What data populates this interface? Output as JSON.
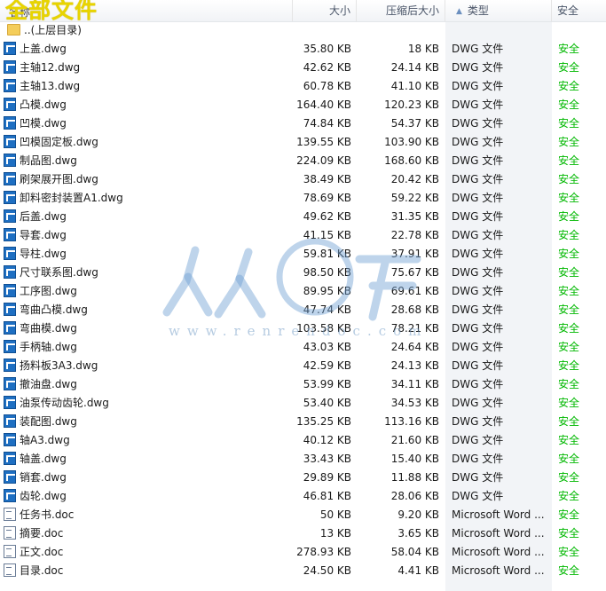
{
  "header": {
    "overlay_title": "全部文件",
    "col_name": "名称",
    "col_size": "大小",
    "col_compressed": "压缩后大小",
    "col_type": "类型",
    "col_security": "安全"
  },
  "parent_dir": "..(上层目录)",
  "files": [
    {
      "name": "上盖.dwg",
      "size": "35.80 KB",
      "compressed": "18 KB",
      "type": "DWG 文件",
      "security": "安全",
      "icon": "dwg"
    },
    {
      "name": "主轴12.dwg",
      "size": "42.62 KB",
      "compressed": "24.14 KB",
      "type": "DWG 文件",
      "security": "安全",
      "icon": "dwg"
    },
    {
      "name": "主轴13.dwg",
      "size": "60.78 KB",
      "compressed": "41.10 KB",
      "type": "DWG 文件",
      "security": "安全",
      "icon": "dwg"
    },
    {
      "name": "凸模.dwg",
      "size": "164.40 KB",
      "compressed": "120.23 KB",
      "type": "DWG 文件",
      "security": "安全",
      "icon": "dwg"
    },
    {
      "name": "凹模.dwg",
      "size": "74.84 KB",
      "compressed": "54.37 KB",
      "type": "DWG 文件",
      "security": "安全",
      "icon": "dwg"
    },
    {
      "name": "凹模固定板.dwg",
      "size": "139.55 KB",
      "compressed": "103.90 KB",
      "type": "DWG 文件",
      "security": "安全",
      "icon": "dwg"
    },
    {
      "name": "制品图.dwg",
      "size": "224.09 KB",
      "compressed": "168.60 KB",
      "type": "DWG 文件",
      "security": "安全",
      "icon": "dwg"
    },
    {
      "name": "刷架展开图.dwg",
      "size": "38.49 KB",
      "compressed": "20.42 KB",
      "type": "DWG 文件",
      "security": "安全",
      "icon": "dwg"
    },
    {
      "name": "卸料密封装置A1.dwg",
      "size": "78.69 KB",
      "compressed": "59.22 KB",
      "type": "DWG 文件",
      "security": "安全",
      "icon": "dwg"
    },
    {
      "name": "后盖.dwg",
      "size": "49.62 KB",
      "compressed": "31.35 KB",
      "type": "DWG 文件",
      "security": "安全",
      "icon": "dwg"
    },
    {
      "name": "导套.dwg",
      "size": "41.15 KB",
      "compressed": "22.78 KB",
      "type": "DWG 文件",
      "security": "安全",
      "icon": "dwg"
    },
    {
      "name": "导柱.dwg",
      "size": "59.81 KB",
      "compressed": "37.91 KB",
      "type": "DWG 文件",
      "security": "安全",
      "icon": "dwg"
    },
    {
      "name": "尺寸联系图.dwg",
      "size": "98.50 KB",
      "compressed": "75.67 KB",
      "type": "DWG 文件",
      "security": "安全",
      "icon": "dwg"
    },
    {
      "name": "工序图.dwg",
      "size": "89.95 KB",
      "compressed": "69.61 KB",
      "type": "DWG 文件",
      "security": "安全",
      "icon": "dwg"
    },
    {
      "name": "弯曲凸模.dwg",
      "size": "47.74 KB",
      "compressed": "28.68 KB",
      "type": "DWG 文件",
      "security": "安全",
      "icon": "dwg"
    },
    {
      "name": "弯曲模.dwg",
      "size": "103.58 KB",
      "compressed": "78.21 KB",
      "type": "DWG 文件",
      "security": "安全",
      "icon": "dwg"
    },
    {
      "name": "手柄轴.dwg",
      "size": "43.03 KB",
      "compressed": "24.64 KB",
      "type": "DWG 文件",
      "security": "安全",
      "icon": "dwg"
    },
    {
      "name": "扬料板3A3.dwg",
      "size": "42.59 KB",
      "compressed": "24.13 KB",
      "type": "DWG 文件",
      "security": "安全",
      "icon": "dwg"
    },
    {
      "name": "撤油盘.dwg",
      "size": "53.99 KB",
      "compressed": "34.11 KB",
      "type": "DWG 文件",
      "security": "安全",
      "icon": "dwg"
    },
    {
      "name": "油泵传动齿轮.dwg",
      "size": "53.40 KB",
      "compressed": "34.53 KB",
      "type": "DWG 文件",
      "security": "安全",
      "icon": "dwg"
    },
    {
      "name": "装配图.dwg",
      "size": "135.25 KB",
      "compressed": "113.16 KB",
      "type": "DWG 文件",
      "security": "安全",
      "icon": "dwg"
    },
    {
      "name": "轴A3.dwg",
      "size": "40.12 KB",
      "compressed": "21.60 KB",
      "type": "DWG 文件",
      "security": "安全",
      "icon": "dwg"
    },
    {
      "name": "轴盖.dwg",
      "size": "33.43 KB",
      "compressed": "15.40 KB",
      "type": "DWG 文件",
      "security": "安全",
      "icon": "dwg"
    },
    {
      "name": "销套.dwg",
      "size": "29.89 KB",
      "compressed": "11.88 KB",
      "type": "DWG 文件",
      "security": "安全",
      "icon": "dwg"
    },
    {
      "name": "齿轮.dwg",
      "size": "46.81 KB",
      "compressed": "28.06 KB",
      "type": "DWG 文件",
      "security": "安全",
      "icon": "dwg"
    },
    {
      "name": "任务书.doc",
      "size": "50 KB",
      "compressed": "9.20 KB",
      "type": "Microsoft Word ...",
      "security": "安全",
      "icon": "doc"
    },
    {
      "name": "摘要.doc",
      "size": "13 KB",
      "compressed": "3.65 KB",
      "type": "Microsoft Word ...",
      "security": "安全",
      "icon": "doc"
    },
    {
      "name": "正文.doc",
      "size": "278.93 KB",
      "compressed": "58.04 KB",
      "type": "Microsoft Word ...",
      "security": "安全",
      "icon": "doc"
    },
    {
      "name": "目录.doc",
      "size": "24.50 KB",
      "compressed": "4.41 KB",
      "type": "Microsoft Word ...",
      "security": "安全",
      "icon": "doc"
    }
  ],
  "watermark": {
    "logo_text": "人人文库",
    "url_text": "www.renrendoc.com"
  },
  "colors": {
    "security_green": "#00b800",
    "dwg_icon": "#1e6fc2",
    "title_yellow": "#e8d400"
  }
}
